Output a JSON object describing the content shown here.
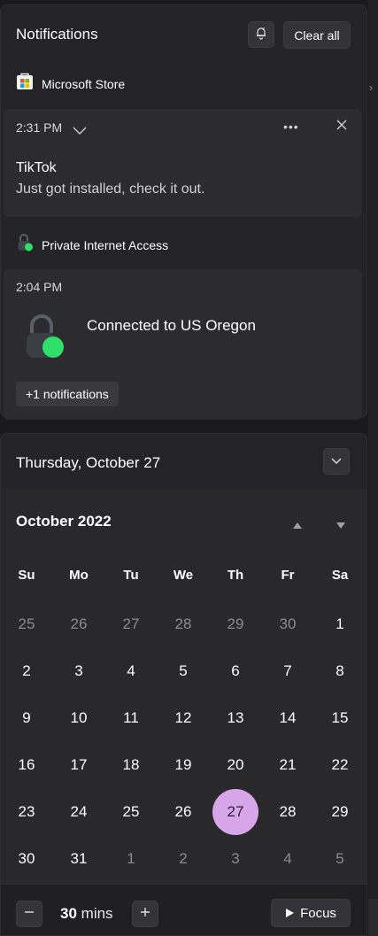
{
  "notifications": {
    "title": "Notifications",
    "clear_all_label": "Clear all",
    "groups": [
      {
        "app": "Microsoft Store",
        "time": "2:31 PM",
        "title": "TikTok",
        "body": "Just got installed, check it out."
      },
      {
        "app": "Private Internet Access",
        "time": "2:04 PM",
        "body": "Connected to US Oregon",
        "more_label": "+1 notifications"
      }
    ]
  },
  "calendar": {
    "date_header": "Thursday, October 27",
    "month_title": "October 2022",
    "weekdays": [
      "Su",
      "Mo",
      "Tu",
      "We",
      "Th",
      "Fr",
      "Sa"
    ],
    "weeks": [
      [
        "25",
        "26",
        "27",
        "28",
        "29",
        "30",
        "1"
      ],
      [
        "2",
        "3",
        "4",
        "5",
        "6",
        "7",
        "8"
      ],
      [
        "9",
        "10",
        "11",
        "12",
        "13",
        "14",
        "15"
      ],
      [
        "16",
        "17",
        "18",
        "19",
        "20",
        "21",
        "22"
      ],
      [
        "23",
        "24",
        "25",
        "26",
        "27",
        "28",
        "29"
      ],
      [
        "30",
        "31",
        "1",
        "2",
        "3",
        "4",
        "5"
      ]
    ],
    "today": "27"
  },
  "focus": {
    "duration_value": "30",
    "duration_unit": "mins",
    "button_label": "Focus"
  },
  "colors": {
    "today_highlight": "#d7a6e8",
    "pia_green": "#2ee06a"
  }
}
